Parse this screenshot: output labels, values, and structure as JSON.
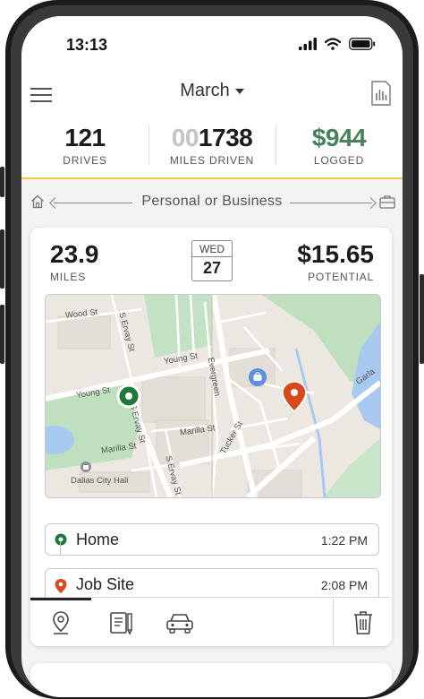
{
  "status": {
    "time": "13:13"
  },
  "header": {
    "month": "March"
  },
  "stats": {
    "drives": {
      "value": "121",
      "label": "DRIVES"
    },
    "miles": {
      "value_dim": "00",
      "value": "1738",
      "label": "MILES DRIVEN"
    },
    "logged": {
      "value": "$944",
      "label": "LOGGED"
    }
  },
  "classify": {
    "label": "Personal or Business"
  },
  "trip": {
    "miles": "23.9",
    "miles_label": "MILES",
    "date_dow": "WED",
    "date_day": "27",
    "potential": "$15.65",
    "potential_label": "POTENTIAL",
    "map_labels": {
      "wood_st": "Wood St",
      "s_ervay_st": "S Ervay St",
      "young_st_top": "Young St",
      "young_st_left": "Young St",
      "evergreen": "Evergreen",
      "marilla_st_right": "Marilla St",
      "marilla_st_left": "Marilla St",
      "tucker_st": "Tucker St",
      "s_ervay_lower": "S Ervay St",
      "s_ervay_low2": "S Ervay St",
      "dallas_city_hall": "Dallas City Hall",
      "garland": "Garla"
    },
    "stops": [
      {
        "name": "Home",
        "time": "1:22 PM",
        "color": "#1f7a3a"
      },
      {
        "name": "Job Site",
        "time": "2:08 PM",
        "color": "#d64a1e"
      }
    ]
  },
  "colors": {
    "accent_yellow": "#f5c84a",
    "logged_green": "#47805b",
    "start_green": "#1f7a3a",
    "end_orange": "#d64a1e"
  },
  "icons": {
    "menu": "hamburger-menu-icon",
    "report": "report-icon",
    "home": "home-icon",
    "business": "briefcase-icon",
    "map_tool": "map-pin-icon",
    "notes_tool": "notes-icon",
    "vehicle_tool": "car-icon",
    "delete": "trash-icon"
  }
}
